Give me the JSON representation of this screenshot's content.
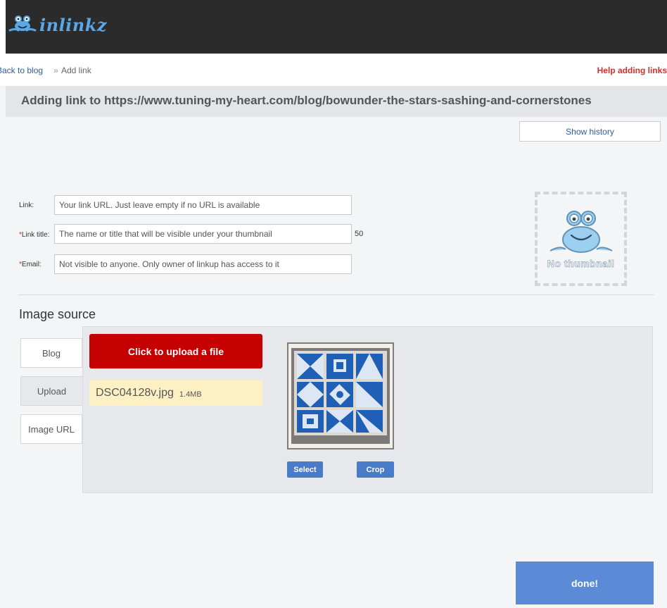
{
  "header": {
    "logo_text": "inlinkz",
    "logo_icon": "frog-logo-icon",
    "background": "#2b2b2b"
  },
  "breadcrumb": {
    "back_label": "Back to blog",
    "separator": "»",
    "current": "Add link",
    "help_label": "Help adding links"
  },
  "page_title": "Adding link to https://www.tuning-my-heart.com/blog/bowunder-the-stars-sashing-and-cornerstones",
  "show_history_label": "Show history",
  "form": {
    "link": {
      "label": "Link:",
      "required": false,
      "placeholder": "Your link URL. Just leave empty if no URL is available",
      "value": ""
    },
    "title": {
      "label": "Link title:",
      "required": true,
      "placeholder": "The name or title that will be visible under your thumbnail",
      "value": "",
      "remaining": "50"
    },
    "email": {
      "label": "Email:",
      "required": true,
      "placeholder": "Not visible to anyone. Only owner of linkup has access to it",
      "value": ""
    },
    "required_marker": "*"
  },
  "thumbnail": {
    "placeholder_text": "No thumbnail",
    "icon": "frog-icon"
  },
  "image_source": {
    "title": "Image source",
    "tabs": [
      {
        "label": "Blog",
        "active": false
      },
      {
        "label": "Upload",
        "active": true
      },
      {
        "label": "Image URL",
        "active": false
      }
    ],
    "upload_button": "Click to upload a file",
    "file": {
      "name": "DSC04128v.jpg",
      "size": "1.4MB"
    },
    "preview_icon": "quilt-image",
    "select_label": "Select",
    "crop_label": "Crop"
  },
  "done_label": "done!",
  "colors": {
    "accent_red": "#c40000",
    "button_blue": "#4a7bc9",
    "done_blue": "#5b8bd6",
    "help_red": "#d0312d",
    "file_bg": "#fdf1c3"
  }
}
